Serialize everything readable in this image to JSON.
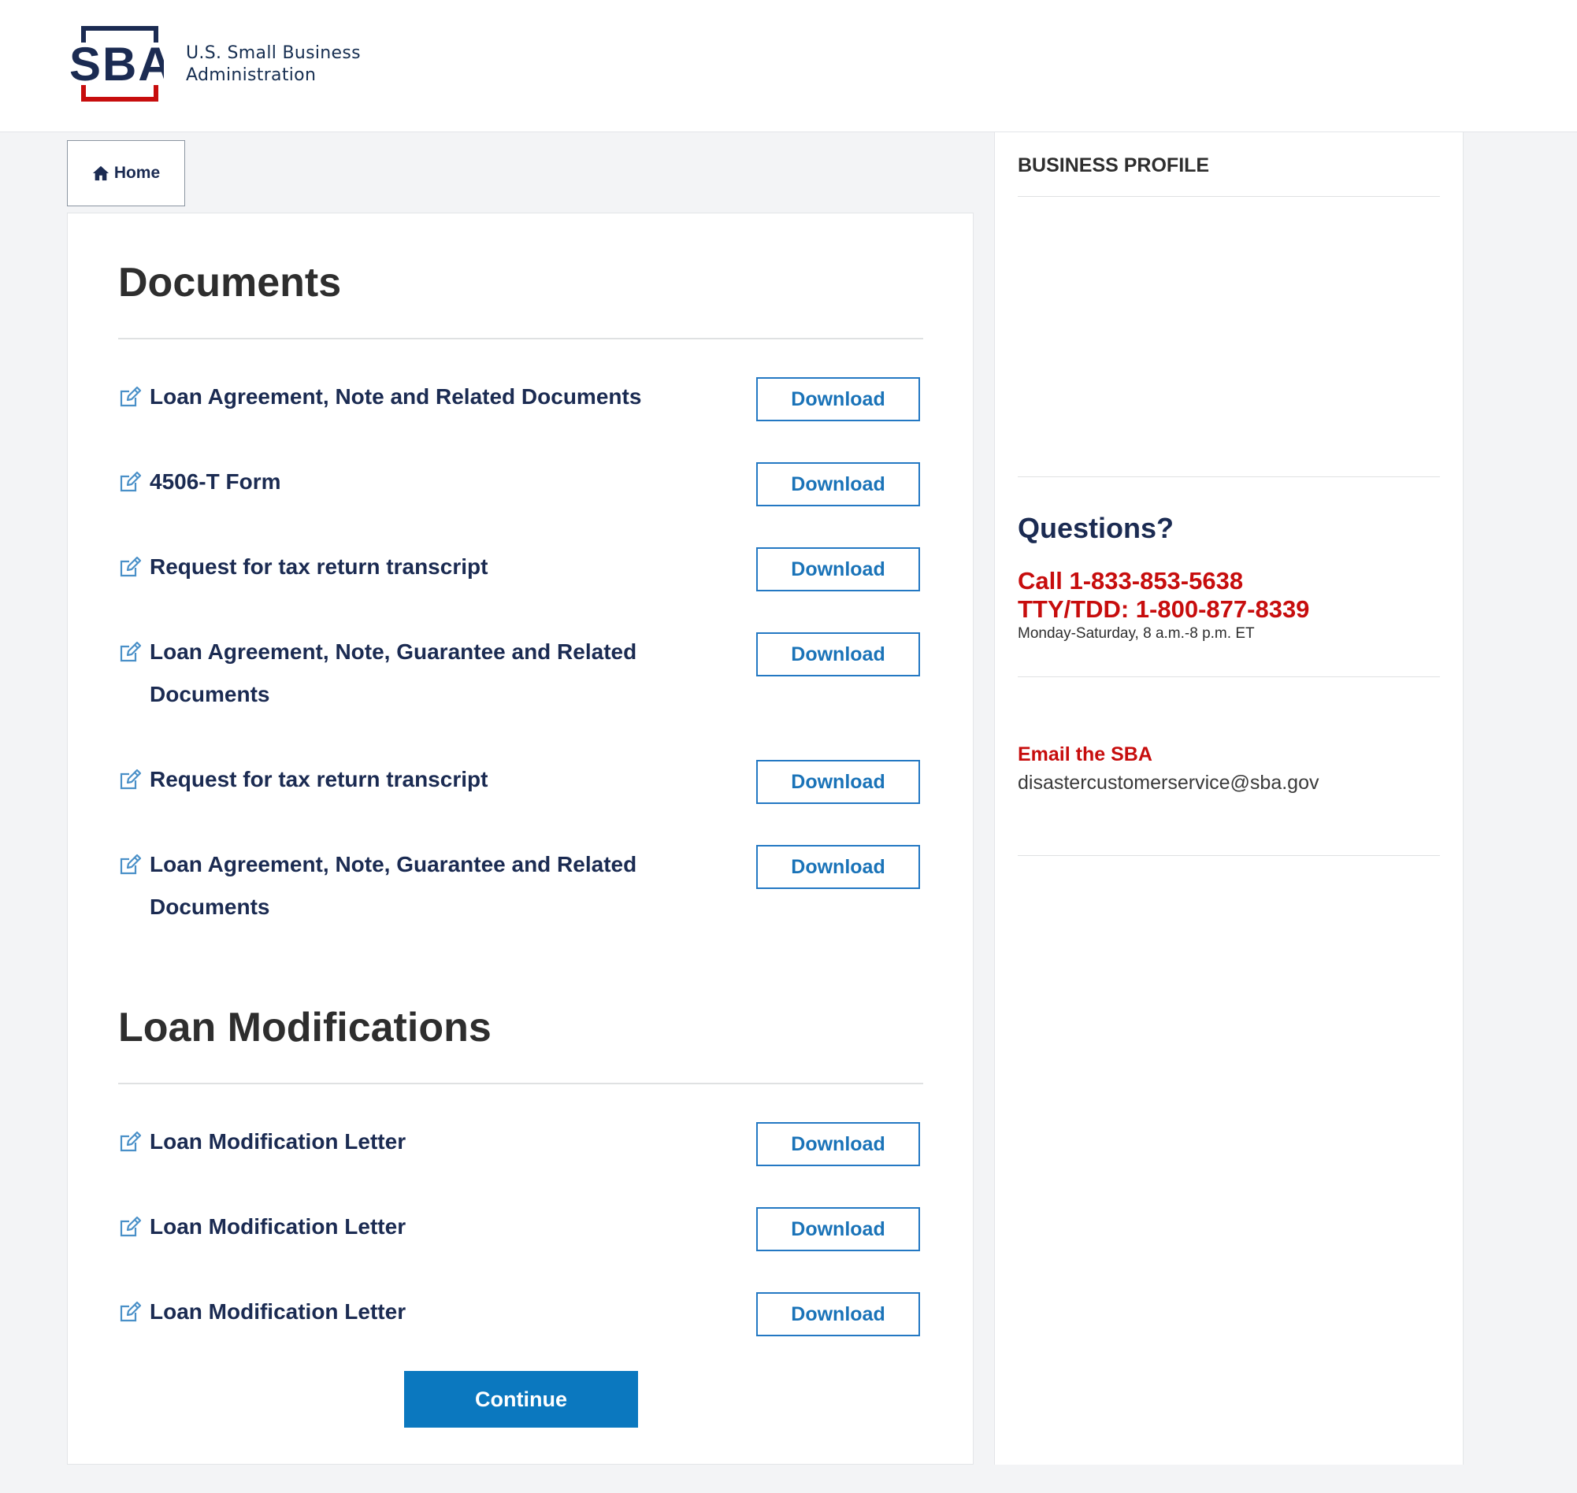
{
  "header": {
    "logo_text": "SBA",
    "agency_line1": "U.S. Small Business",
    "agency_line2": "Administration"
  },
  "nav": {
    "home_label": "Home"
  },
  "documents": {
    "title": "Documents",
    "download_label": "Download",
    "items": [
      {
        "label": "Loan Agreement, Note and Related Documents"
      },
      {
        "label": "4506-T Form"
      },
      {
        "label": "Request for tax return transcript"
      },
      {
        "label": "Loan Agreement, Note, Guarantee and Related Documents"
      },
      {
        "label": "Request for tax return transcript"
      },
      {
        "label": "Loan Agreement, Note, Guarantee and Related Documents"
      }
    ]
  },
  "loan_modifications": {
    "title": "Loan Modifications",
    "download_label": "Download",
    "items": [
      {
        "label": "Loan Modification Letter"
      },
      {
        "label": "Loan Modification Letter"
      },
      {
        "label": "Loan Modification Letter"
      }
    ]
  },
  "actions": {
    "continue_label": "Continue"
  },
  "sidebar": {
    "profile_heading": "BUSINESS PROFILE",
    "questions_title": "Questions?",
    "phone_call": "Call 1-833-853-5638",
    "phone_tty": "TTY/TDD: 1-800-877-8339",
    "hours": "Monday-Saturday, 8 a.m.-8 p.m. ET",
    "email_label": "Email the SBA",
    "email_value": "disastercustomerservice@sba.gov"
  },
  "colors": {
    "navy": "#1b2b52",
    "sba_red": "#c70d0d",
    "primary_blue": "#0b78bf",
    "link_blue": "#1a73b8"
  },
  "icons": {
    "home": "home-icon",
    "document": "edit-document-icon"
  }
}
